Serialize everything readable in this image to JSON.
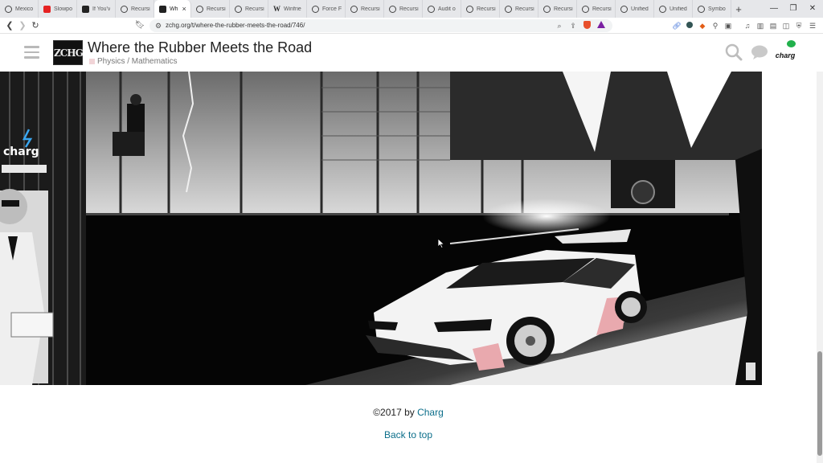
{
  "browser": {
    "tabs": [
      {
        "label": "Mexico",
        "icon": "circle-icon"
      },
      {
        "label": "Slowpo",
        "icon": "youtube-icon"
      },
      {
        "label": "If You'v",
        "icon": "page-icon"
      },
      {
        "label": "Recursi",
        "icon": "discourse-icon"
      },
      {
        "label": "Wh",
        "icon": "zchg-icon",
        "active": true
      },
      {
        "label": "Recursi",
        "icon": "discourse-icon"
      },
      {
        "label": "Recursi",
        "icon": "discourse-icon"
      },
      {
        "label": "Winfrie",
        "icon": "wikipedia-icon"
      },
      {
        "label": "Force F",
        "icon": "discourse-icon"
      },
      {
        "label": "Recursi",
        "icon": "discourse-icon"
      },
      {
        "label": "Recursi",
        "icon": "discourse-icon"
      },
      {
        "label": "Audit o",
        "icon": "discourse-icon"
      },
      {
        "label": "Recursi",
        "icon": "discourse-icon"
      },
      {
        "label": "Recursi",
        "icon": "discourse-icon"
      },
      {
        "label": "Recursi",
        "icon": "discourse-icon"
      },
      {
        "label": "Recursi",
        "icon": "openai-icon"
      },
      {
        "label": "Unified",
        "icon": "openai-icon"
      },
      {
        "label": "Unified",
        "icon": "openai-icon"
      },
      {
        "label": "Symbo",
        "icon": "openai-icon"
      }
    ],
    "new_tab_label": "+",
    "url": "zchg.org/t/where-the-rubber-meets-the-road/746/"
  },
  "site": {
    "logo_text": "ZCHG",
    "topic_title": "Where the Rubber Meets the Road",
    "category": "Physics / Mathematics",
    "category_color": "#f1d4d7",
    "avatar_text": "charg",
    "hero_watermark": "charg"
  },
  "footer": {
    "copyright_prefix": "©2017 by ",
    "copyright_author": "Charg",
    "back_to_top": "Back to top",
    "link_color": "#0b6e8a"
  }
}
